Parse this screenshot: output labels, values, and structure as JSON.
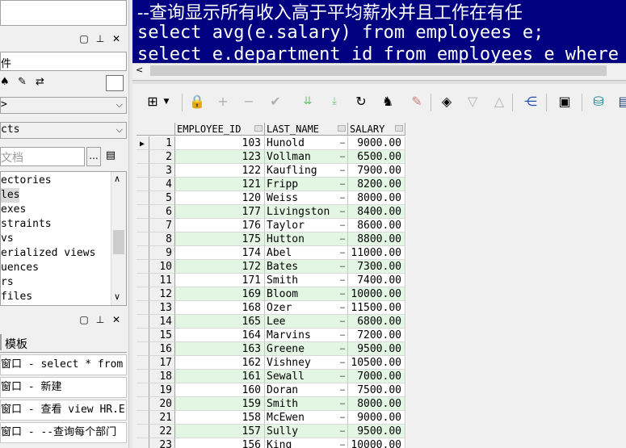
{
  "left_panel": {
    "top_box_text": "",
    "panel1_label": "件",
    "combo1": ">",
    "combo2": "cts",
    "search_placeholder": "文档",
    "search_button": "...",
    "objects": [
      "ectories",
      "les",
      "exes",
      "straints",
      "vs",
      "erialized views",
      "uences",
      "rs",
      "files"
    ],
    "selected_object_index": 1,
    "tab_label": "模板",
    "windows": [
      "窗口 - select * from",
      "窗口 - 新建",
      "窗口 - 查看 view HR.E",
      "窗口 - --查询每个部门"
    ]
  },
  "editor": {
    "lines": [
      "--查询显示所有收入高于平均薪水并且工作在有任",
      "select avg(e.salary) from employees e;",
      "select e.department_id from employees e where"
    ]
  },
  "toolbar": {
    "icons": [
      "grid-menu-icon",
      "lock-icon",
      "add-row-icon",
      "delete-row-icon",
      "post-icon",
      "fetch-next-icon",
      "fetch-all-icon",
      "refresh-icon",
      "find-icon",
      "clear-icon",
      "query-by-example-icon",
      "sort-down-icon",
      "sort-up-icon",
      "single-record-icon",
      "save-icon",
      "export-icon",
      "print-icon"
    ]
  },
  "grid": {
    "columns": [
      "EMPLOYEE_ID",
      "LAST_NAME",
      "SALARY"
    ],
    "rows": [
      {
        "n": "1",
        "id": "103",
        "last_name": "Hunold",
        "salary": "9000.00"
      },
      {
        "n": "2",
        "id": "123",
        "last_name": "Vollman",
        "salary": "6500.00"
      },
      {
        "n": "3",
        "id": "122",
        "last_name": "Kaufling",
        "salary": "7900.00"
      },
      {
        "n": "4",
        "id": "121",
        "last_name": "Fripp",
        "salary": "8200.00"
      },
      {
        "n": "5",
        "id": "120",
        "last_name": "Weiss",
        "salary": "8000.00"
      },
      {
        "n": "6",
        "id": "177",
        "last_name": "Livingston",
        "salary": "8400.00"
      },
      {
        "n": "7",
        "id": "176",
        "last_name": "Taylor",
        "salary": "8600.00"
      },
      {
        "n": "8",
        "id": "175",
        "last_name": "Hutton",
        "salary": "8800.00"
      },
      {
        "n": "9",
        "id": "174",
        "last_name": "Abel",
        "salary": "11000.00"
      },
      {
        "n": "10",
        "id": "172",
        "last_name": "Bates",
        "salary": "7300.00"
      },
      {
        "n": "11",
        "id": "171",
        "last_name": "Smith",
        "salary": "7400.00"
      },
      {
        "n": "12",
        "id": "169",
        "last_name": "Bloom",
        "salary": "10000.00"
      },
      {
        "n": "13",
        "id": "168",
        "last_name": "Ozer",
        "salary": "11500.00"
      },
      {
        "n": "14",
        "id": "165",
        "last_name": "Lee",
        "salary": "6800.00"
      },
      {
        "n": "15",
        "id": "164",
        "last_name": "Marvins",
        "salary": "7200.00"
      },
      {
        "n": "16",
        "id": "163",
        "last_name": "Greene",
        "salary": "9500.00"
      },
      {
        "n": "17",
        "id": "162",
        "last_name": "Vishney",
        "salary": "10500.00"
      },
      {
        "n": "18",
        "id": "161",
        "last_name": "Sewall",
        "salary": "7000.00"
      },
      {
        "n": "19",
        "id": "160",
        "last_name": "Doran",
        "salary": "7500.00"
      },
      {
        "n": "20",
        "id": "159",
        "last_name": "Smith",
        "salary": "8000.00"
      },
      {
        "n": "21",
        "id": "158",
        "last_name": "McEwen",
        "salary": "9000.00"
      },
      {
        "n": "22",
        "id": "157",
        "last_name": "Sully",
        "salary": "9500.00"
      },
      {
        "n": "23",
        "id": "156",
        "last_name": "King",
        "salary": "10000.00"
      }
    ]
  }
}
